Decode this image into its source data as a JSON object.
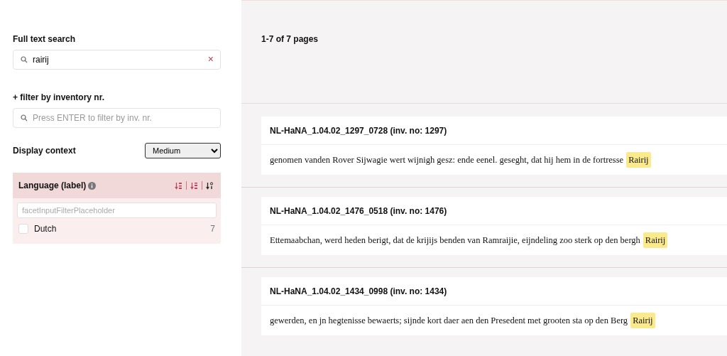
{
  "sidebar": {
    "full_text_search": {
      "label": "Full text search",
      "value": "rairij",
      "clear": "×"
    },
    "inventory_filter": {
      "label": "+ filter by inventory nr.",
      "placeholder": "Press ENTER to filter by inv. nr."
    },
    "display_context": {
      "label": "Display context",
      "value": "Medium"
    },
    "facet": {
      "title": "Language (label)",
      "sort_buttons": [
        {
          "kind": "alpha-asc",
          "selected": false
        },
        {
          "kind": "alpha-desc",
          "selected": false
        },
        {
          "kind": "count",
          "selected": true
        }
      ],
      "filter_placeholder": "facetInputFilterPlaceholder",
      "options": [
        {
          "label": "Dutch",
          "count": "7",
          "checked": false
        }
      ]
    }
  },
  "results": {
    "summary": "1-7 of 7 pages",
    "items": [
      {
        "title": "NL-HaNA_1.04.02_1297_0728 (inv. no: 1297)",
        "snippet": "genomen vanden Rover Sijwagie wert wijnigh gesz: ende eenel. geseght, dat hij hem in de fortresse",
        "highlight": "Rairij"
      },
      {
        "title": "NL-HaNA_1.04.02_1476_0518 (inv. no: 1476)",
        "snippet": "Ettemaabchan, werd heden berigt, dat de krijijs benden van Ramraijie, eijndeling zoo sterk op den bergh",
        "highlight": "Rairij"
      },
      {
        "title": "NL-HaNA_1.04.02_1434_0998 (inv. no: 1434)",
        "snippet": "gewerden, en jn hegtenisse bewaerts; sijnde kort daer aen den Presedent met grooten sta op den Berg",
        "highlight": "Rairij"
      }
    ]
  }
}
